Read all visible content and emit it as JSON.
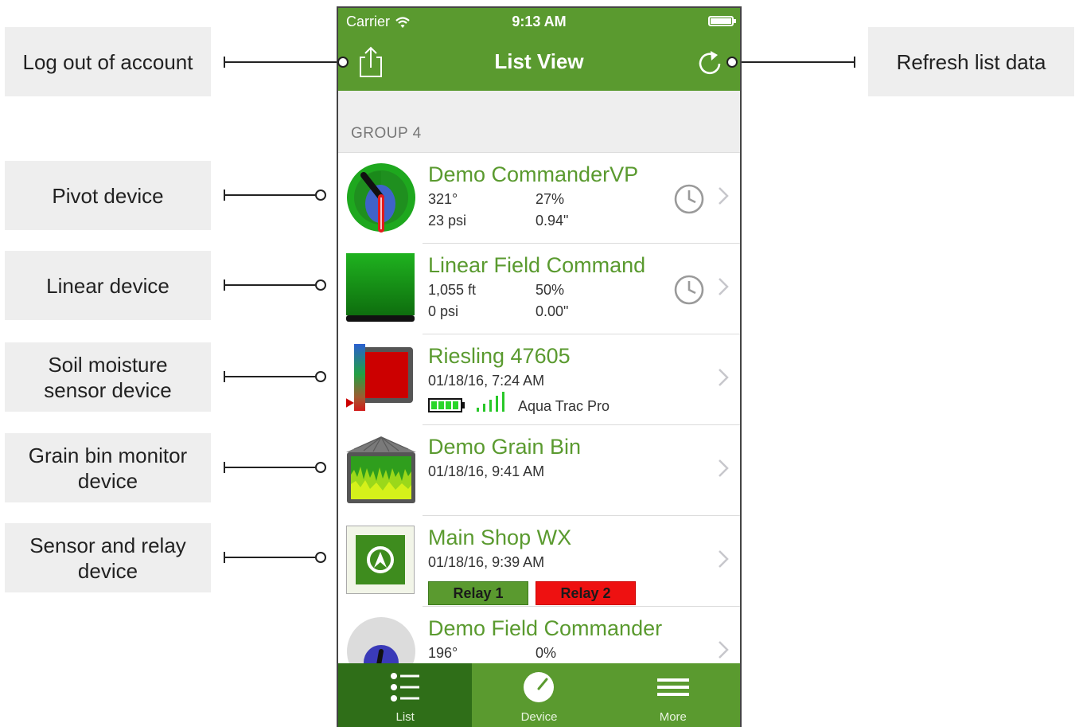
{
  "annotations": {
    "logout": "Log out of account",
    "refresh": "Refresh list data",
    "pivot": "Pivot device",
    "linear": "Linear device",
    "soil_line1": "Soil moisture",
    "soil_line2": "sensor device",
    "grain_line1": "Grain bin monitor",
    "grain_line2": "device",
    "relay_line1": "Sensor and relay",
    "relay_line2": "device"
  },
  "status_bar": {
    "carrier": "Carrier",
    "time": "9:13 AM"
  },
  "nav": {
    "title": "List View",
    "logout_icon": "share-out-icon",
    "refresh_icon": "refresh-icon"
  },
  "group": {
    "header": "GROUP 4"
  },
  "devices": [
    {
      "name": "Demo CommanderVP",
      "stat1": "321°",
      "stat2": "27%",
      "stat3": "23 psi",
      "stat4": "0.94\""
    },
    {
      "name": "Linear Field Command",
      "stat1": "1,055 ft",
      "stat2": "50%",
      "stat3": "0 psi",
      "stat4": "0.00\""
    },
    {
      "name": "Riesling 47605",
      "timestamp": "01/18/16, 7:24 AM",
      "sensor_type": "Aqua Trac Pro"
    },
    {
      "name": "Demo Grain Bin",
      "timestamp": "01/18/16, 9:41 AM"
    },
    {
      "name": "Main Shop WX",
      "timestamp": "01/18/16, 9:39 AM",
      "relay1": "Relay 1",
      "relay2": "Relay 2"
    },
    {
      "name": "Demo Field Commander",
      "stat1": "196°",
      "stat2": "0%"
    }
  ],
  "tabs": [
    {
      "label": "List",
      "icon": "list-icon"
    },
    {
      "label": "Device",
      "icon": "gauge-icon"
    },
    {
      "label": "More",
      "icon": "menu-icon"
    }
  ],
  "colors": {
    "brand_green": "#5a9a2f",
    "tab_active": "#2f6e18",
    "relay_on": "#5a9a2f",
    "relay_off": "#ee1111"
  }
}
